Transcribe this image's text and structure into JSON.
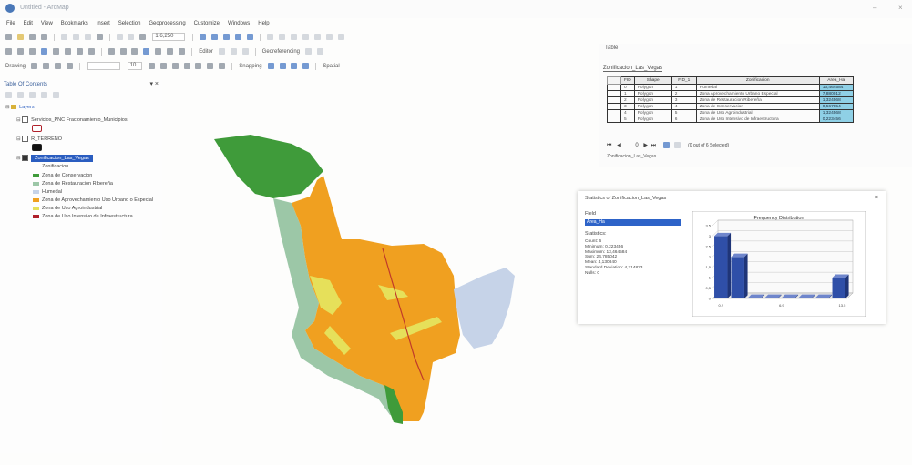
{
  "window": {
    "title": "Untitled - ArcMap",
    "minimize": "–",
    "close": "×"
  },
  "menu": [
    "File",
    "Edit",
    "View",
    "Bookmarks",
    "Insert",
    "Selection",
    "Geoprocessing",
    "Customize",
    "Windows",
    "Help"
  ],
  "toolbar": {
    "scale": "1:6,250",
    "font_size": "10",
    "snapping_label": "Snapping",
    "drawing_label": "Drawing",
    "georef_label": "Georeferencing",
    "spatial_label": "Spatial",
    "editor_label": "Editor"
  },
  "toc": {
    "title": "Table Of Contents",
    "layers_root": "Layers",
    "layer1": "Servicios_PNC Fracionamiento_Municipios",
    "layer2": "R_TERRENO",
    "layer3": "Zonificacion_Las_Vegas",
    "field_heading": "Zonificacion",
    "legend": [
      {
        "label": "Zona de Conservacion",
        "color": "#3f9b3a"
      },
      {
        "label": "Zona de Restauracion Ribereña",
        "color": "#9cc7a7"
      },
      {
        "label": "Humedal",
        "color": "#c6d3e8"
      },
      {
        "label": "Zona de Aprovechamiento Uso Urbano o Especial",
        "color": "#f0a020"
      },
      {
        "label": "Zona de Uso Agroindustrial",
        "color": "#e6e05a"
      },
      {
        "label": "Zona de Uso Intensivo de Infraestructura",
        "color": "#b0202a"
      }
    ]
  },
  "table": {
    "title": "Table",
    "tab": "Zonificacion_Las_Vegas",
    "columns": [
      "FID",
      "Shape",
      "FID_1",
      "Zonificacion",
      "Area_Ha"
    ],
    "rows": [
      {
        "fid": "0",
        "shape": "Polygon",
        "fid1": "1",
        "zon": "Humedal",
        "area": "13,464584"
      },
      {
        "fid": "1",
        "shape": "Polygon",
        "fid1": "2",
        "zon": "Zona Aprovechamiento Urbano Especial",
        "area": "7,880012"
      },
      {
        "fid": "2",
        "shape": "Polygon",
        "fid1": "3",
        "zon": "Zona de Restauracion Ribereña",
        "area": "1,324568"
      },
      {
        "fid": "3",
        "shape": "Polygon",
        "fid1": "4",
        "zon": "Zona de Conservacion",
        "area": "0,567854"
      },
      {
        "fid": "4",
        "shape": "Polygon",
        "fid1": "5",
        "zon": "Zona de Uso Agroindustrial",
        "area": "1,324568"
      },
      {
        "fid": "5",
        "shape": "Polygon",
        "fid1": "6",
        "zon": "Zona de Uso Intensivo de Infraestructura",
        "area": "0,223456"
      }
    ],
    "record": "0",
    "selected": "(0 out of 6 Selected)",
    "footer": "Zonificacion_Las_Vegas"
  },
  "stats": {
    "title": "Statistics of Zonificacion_Las_Vegas",
    "close": "×",
    "field_label": "Field",
    "field_value": "Area_Ha",
    "stats_label": "Statistics:",
    "lines": [
      "Count: 6",
      "Minimum: 0,223456",
      "Maximum: 13,464584",
      "Sum: 24,785042",
      "Mean: 4,130840",
      "Standard Deviation: 4,714823",
      "Nulls: 0"
    ]
  },
  "chart_data": {
    "type": "bar",
    "title": "Frequency Distribution",
    "categories": [
      "0,2",
      "",
      "",
      "",
      "",
      "",
      "",
      "13,5"
    ],
    "tick_labels": [
      "0.2",
      "6.9",
      "13.5"
    ],
    "values": [
      3,
      2,
      0,
      0,
      0,
      0,
      0,
      1
    ],
    "ylim": [
      0,
      3.5
    ],
    "yticks": [
      "0",
      "0,5",
      "1",
      "1,5",
      "2",
      "2,5",
      "3",
      "3,5"
    ],
    "bar_color": "#2f4fa8",
    "xlabel": "",
    "ylabel": ""
  }
}
